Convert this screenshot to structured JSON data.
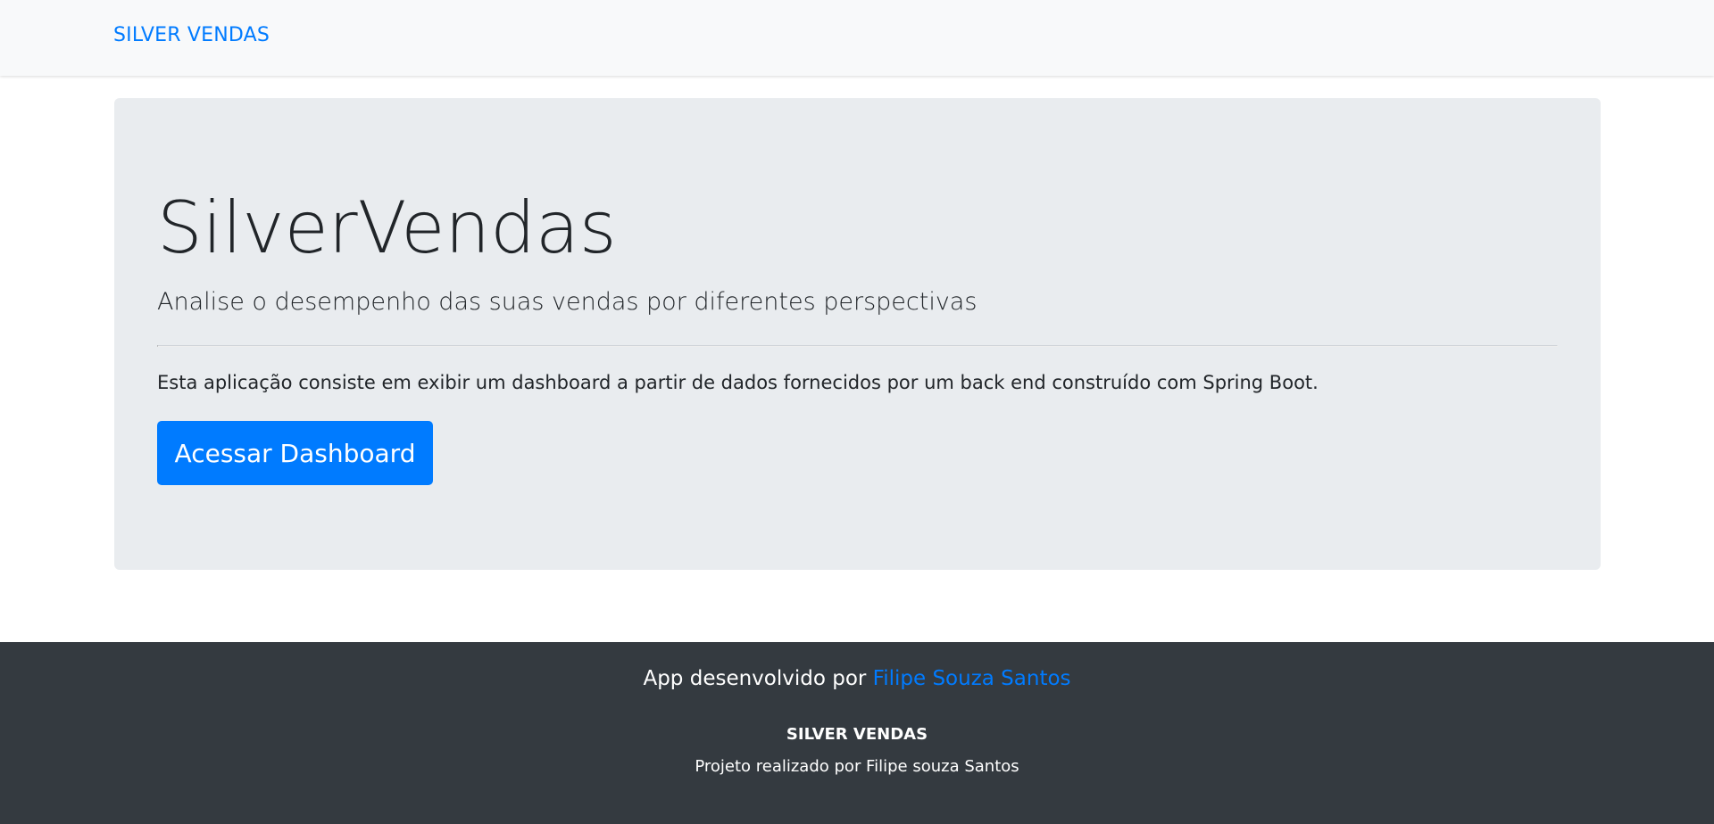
{
  "navbar": {
    "brand": "SILVER VENDAS"
  },
  "hero": {
    "title": "SilverVendas",
    "lead": "Analise o desempenho das suas vendas por diferentes perspectivas",
    "description": "Esta aplicação consiste em exibir um dashboard a partir de dados fornecidos por um back end construído com Spring Boot.",
    "button_label": "Acessar Dashboard"
  },
  "footer": {
    "credit_prefix": "App desenvolvido por ",
    "credit_author": "Filipe Souza Santos",
    "brand": "SILVER VENDAS",
    "project": "Projeto realizado por Filipe souza Santos"
  },
  "colors": {
    "accent": "#007bff",
    "navbar_bg": "#f8f9fa",
    "jumbotron_bg": "#e9ecef",
    "footer_bg": "#343a40"
  }
}
